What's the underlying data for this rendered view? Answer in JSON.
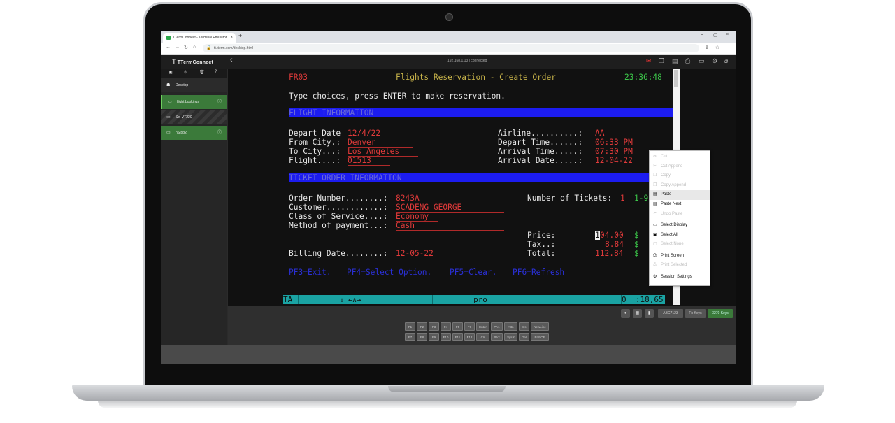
{
  "browser": {
    "tab_title": "TTermConnect - Terminal Emulator",
    "tab_close": "×",
    "new_tab": "+",
    "url": "tt.tterm.com/desktop.html",
    "win_min": "–",
    "win_max": "▢",
    "win_close": "×"
  },
  "app": {
    "logo": "TTermConnect",
    "connection": "192.168.1.13 | connected"
  },
  "sidebar": {
    "items": [
      {
        "label": "Desktop"
      },
      {
        "label": "flight bookings"
      },
      {
        "label": "Sel-VT220"
      },
      {
        "label": "nStop2"
      }
    ]
  },
  "terminal": {
    "header": {
      "code": "FR03",
      "title": "Flights Reservation - Create Order",
      "time": "23:36:48"
    },
    "instructions": "Type choices, press ENTER to make reservation.",
    "section_flight": "FLIGHT INFORMATION",
    "section_ticket": "TICKET ORDER INFORMATION",
    "flight": {
      "depart_date_label": "Depart Date ",
      "depart_date": "12/4/22  ",
      "from_city_label": "From City.: ",
      "from_city": "Denver        ",
      "to_city_label": "To City...: ",
      "to_city": "Los Angeles    ",
      "flight_label": "Flight....: ",
      "flight": "01513    ",
      "airline_label": "Airline..........: ",
      "airline": "AA ",
      "depart_time_label": "Depart Time......: ",
      "depart_time": "06:33 PM",
      "arrival_time_label": "Arrival Time.....: ",
      "arrival_time": "07:30 PM",
      "arrival_date_label": "Arrival Date.....: ",
      "arrival_date": "12-04-22"
    },
    "ticket": {
      "order_number_label": "Order Number........: ",
      "order_number": "8243A",
      "customer_label": "Customer............: ",
      "customer": "SCADENG GEORGE         ",
      "class_label": "Class of Service....: ",
      "class": "Economy  ",
      "payment_label": "Method of payment...: ",
      "payment": "Cash                   ",
      "num_tickets_label": "Number of Tickets: ",
      "num_tickets": "1",
      "num_tickets_range": "1-9",
      "price_label": "Price:",
      "price_cursor": "1",
      "price": "04.00",
      "tax_label": "Tax..:",
      "tax": "8.84",
      "total_label": "Total:",
      "total": "112.84",
      "currency": "$",
      "billing_date_label": "Billing Date........: ",
      "billing_date": "12-05-22"
    },
    "fkeys": {
      "f3": "PF3=Exit.",
      "f4": "PF4=Select Option.",
      "f5": "PF5=Clear.",
      "f6": "PF6=Refresh"
    },
    "status": {
      "ta": "TA",
      "arrows": "⇧ ←∧→",
      "mode": "pro",
      "pos": "0  :18,65"
    }
  },
  "context_menu": {
    "items": [
      {
        "label": "Cut",
        "enabled": false
      },
      {
        "label": "Cut Append",
        "enabled": false
      },
      {
        "label": "Copy",
        "enabled": false
      },
      {
        "label": "Copy Append",
        "enabled": false
      },
      {
        "label": "Paste",
        "enabled": true
      },
      {
        "label": "Paste Next",
        "enabled": true
      },
      {
        "label": "Undo Paste",
        "enabled": false
      },
      {
        "label": "Select Display",
        "enabled": true
      },
      {
        "label": "Select All",
        "enabled": true
      },
      {
        "label": "Select None",
        "enabled": false
      },
      {
        "label": "Print Screen",
        "enabled": true
      },
      {
        "label": "Print Selected",
        "enabled": false
      },
      {
        "label": "Session Settings",
        "enabled": true
      }
    ]
  },
  "bottom_toolbar": {
    "terminal_type": "ABC7123",
    "fn_keys": "Fn Keys",
    "keys_3270": "3270 Keys"
  },
  "keypad": {
    "row1": [
      "F1",
      "F2",
      "F3",
      "F4",
      "F5",
      "F6",
      "Enter",
      "PA1",
      "Attn",
      "Ins",
      "NewLine"
    ],
    "row2": [
      "F7",
      "F8",
      "F9",
      "F10",
      "F11",
      "F12",
      "Clr",
      "PA2",
      "SysR",
      "Del",
      "Er EOF"
    ]
  },
  "colors": {
    "terminal_bg": "#111111",
    "field_red": "#e03a3a",
    "title_yellow": "#c8b44a",
    "ok_green": "#3cc84a",
    "section_blue": "#1c1cf0",
    "status_teal": "#1aa3a3",
    "sidebar_active_green": "#3b7a3a"
  }
}
